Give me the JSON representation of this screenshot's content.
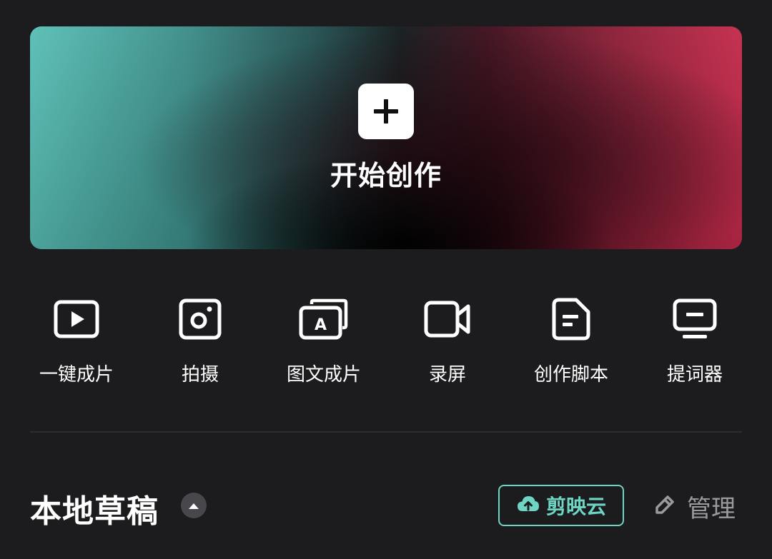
{
  "hero": {
    "title": "开始创作"
  },
  "tools": [
    {
      "label": "一键成片",
      "icon": "play-video-icon"
    },
    {
      "label": "拍摄",
      "icon": "camera-icon"
    },
    {
      "label": "图文成片",
      "icon": "text-to-video-icon"
    },
    {
      "label": "录屏",
      "icon": "screen-record-icon"
    },
    {
      "label": "创作脚本",
      "icon": "script-document-icon"
    },
    {
      "label": "提词器",
      "icon": "teleprompter-icon"
    }
  ],
  "drafts": {
    "title": "本地草稿",
    "cloud_label": "剪映云",
    "manage_label": "管理"
  },
  "colors": {
    "background": "#1c1c1e",
    "accent": "#6ed4c3",
    "muted": "#9a9a9e"
  }
}
